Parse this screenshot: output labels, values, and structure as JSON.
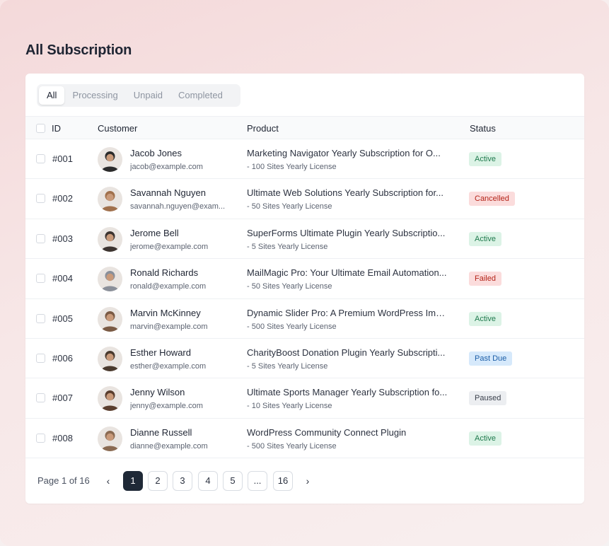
{
  "title": "All Subscription",
  "tabs": [
    {
      "label": "All",
      "active": true
    },
    {
      "label": "Processing",
      "active": false
    },
    {
      "label": "Unpaid",
      "active": false
    },
    {
      "label": "Completed",
      "active": false
    }
  ],
  "columns": {
    "id": "ID",
    "customer": "Customer",
    "product": "Product",
    "status": "Status"
  },
  "rows": [
    {
      "id": "#001",
      "name": "Jacob Jones",
      "email": "jacob@example.com",
      "product": "Marketing Navigator  Yearly Subscription for O...",
      "license": "- 100 Sites Yearly License",
      "status": "Active"
    },
    {
      "id": "#002",
      "name": "Savannah Nguyen",
      "email": "savannah.nguyen@exam...",
      "product": "Ultimate Web Solutions Yearly Subscription for...",
      "license": "- 50 Sites Yearly License",
      "status": "Cancelled"
    },
    {
      "id": "#003",
      "name": "Jerome Bell",
      "email": "jerome@example.com",
      "product": "SuperForms Ultimate Plugin Yearly Subscriptio...",
      "license": "- 5 Sites Yearly License",
      "status": "Active"
    },
    {
      "id": "#004",
      "name": "Ronald Richards",
      "email": "ronald@example.com",
      "product": "MailMagic Pro: Your Ultimate Email Automation...",
      "license": "- 50 Sites Yearly License",
      "status": "Failed"
    },
    {
      "id": "#005",
      "name": "Marvin McKinney",
      "email": "marvin@example.com",
      "product": "Dynamic Slider Pro: A Premium WordPress Ima...",
      "license": "- 500 Sites Yearly License",
      "status": "Active"
    },
    {
      "id": "#006",
      "name": "Esther Howard",
      "email": "esther@example.com",
      "product": "CharityBoost Donation Plugin Yearly Subscripti...",
      "license": "- 5 Sites Yearly License",
      "status": "Past Due"
    },
    {
      "id": "#007",
      "name": "Jenny Wilson",
      "email": "jenny@example.com",
      "product": "Ultimate Sports Manager Yearly Subscription fo...",
      "license": "- 10 Sites Yearly License",
      "status": "Paused"
    },
    {
      "id": "#008",
      "name": "Dianne Russell",
      "email": "dianne@example.com",
      "product": "WordPress Community Connect Plugin",
      "license": "- 500 Sites Yearly License",
      "status": "Active"
    }
  ],
  "status_colors": {
    "Active": {
      "bg": "#dcf3e6",
      "fg": "#1f7a4d"
    },
    "Cancelled": {
      "bg": "#fbdcdc",
      "fg": "#b42318"
    },
    "Failed": {
      "bg": "#fbdcdc",
      "fg": "#b42318"
    },
    "Past Due": {
      "bg": "#d6e9fb",
      "fg": "#1d5fa8"
    },
    "Paused": {
      "bg": "#eceef1",
      "fg": "#3a404c"
    }
  },
  "avatar_colors": [
    "#2b2b2b",
    "#a0704c",
    "#3d3430",
    "#8a8f99",
    "#7a5a44",
    "#4a3a2e",
    "#5a3e2e",
    "#8a6a52"
  ],
  "pagination": {
    "info": "Page 1 of 16",
    "prev_icon": "chevron-left-icon",
    "next_icon": "chevron-right-icon",
    "pages": [
      "1",
      "2",
      "3",
      "4",
      "5",
      "...",
      "16"
    ],
    "current": "1"
  }
}
